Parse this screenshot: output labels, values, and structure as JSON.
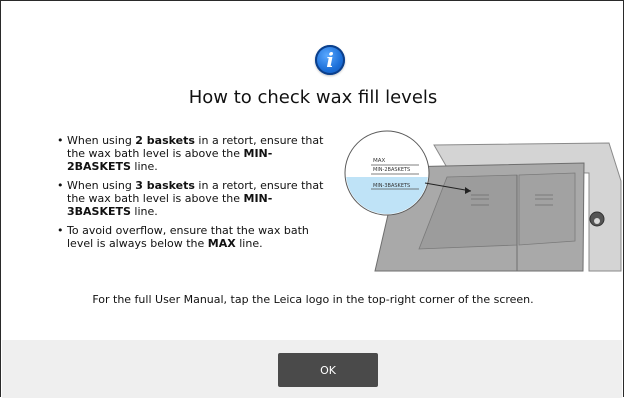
{
  "dialog": {
    "icon": "info-icon",
    "icon_glyph": "i",
    "title": "How to check wax fill levels",
    "bullets": [
      {
        "parts": [
          {
            "text": "When using ",
            "bold": false
          },
          {
            "text": "2 baskets",
            "bold": true
          },
          {
            "text": " in a retort, ensure that the wax bath level is above the ",
            "bold": false
          },
          {
            "text": "MIN-2BASKETS",
            "bold": true
          },
          {
            "text": " line.",
            "bold": false
          }
        ]
      },
      {
        "parts": [
          {
            "text": "When using ",
            "bold": false
          },
          {
            "text": "3 baskets",
            "bold": true
          },
          {
            "text": " in a retort, ensure that the wax bath level is above the ",
            "bold": false
          },
          {
            "text": "MIN-3BASKETS",
            "bold": true
          },
          {
            "text": " line.",
            "bold": false
          }
        ]
      },
      {
        "parts": [
          {
            "text": "To avoid overflow, ensure that the wax bath level is always below the ",
            "bold": false
          },
          {
            "text": "MAX",
            "bold": true
          },
          {
            "text": " line.",
            "bold": false
          }
        ]
      }
    ],
    "illustration": {
      "max_label": "MAX",
      "min2_label": "MIN-2BASKETS",
      "min3_label": "MIN-3BASKETS"
    },
    "footer_note": "For the full User Manual, tap the Leica logo in the top-right corner of the screen.",
    "ok_label": "OK"
  },
  "colors": {
    "info_blue": "#1c6fd8",
    "wax_fill": "#bfe3f7",
    "button_bg": "#4a4a4a",
    "button_bar_bg": "#efefef"
  }
}
